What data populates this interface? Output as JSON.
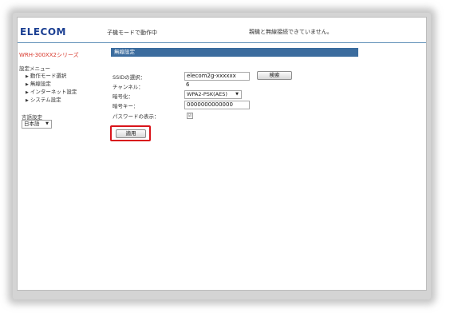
{
  "header": {
    "logo": "ELECOM",
    "mode_text": "子機モードで動作中",
    "status_text": "親機と無線接続できていません。"
  },
  "sidebar": {
    "series": "WRH-300XX2シリーズ",
    "menu_title": "設定メニュー",
    "items": [
      {
        "label": "動作モード選択"
      },
      {
        "label": "無線設定"
      },
      {
        "label": "インターネット設定"
      },
      {
        "label": "システム設定"
      }
    ],
    "language_label": "言語設定",
    "language_value": "日本語"
  },
  "main": {
    "section_title": "無線設定",
    "ssid_label": "SSIDの選択：",
    "ssid_value": "elecom2g-xxxxxx",
    "search_button": "検索",
    "channel_label": "チャンネル：",
    "channel_value": "6",
    "encryption_label": "暗号化：",
    "encryption_value": "WPA2-PSK(AES)",
    "key_label": "暗号キー：",
    "key_value": "0000000000000",
    "show_password_label": "パスワードの表示：",
    "show_password_checked": "☑",
    "apply_button": "適用"
  },
  "colors": {
    "brand": "#1b3f92",
    "section_bar": "#3b6c9e",
    "series_text": "#d83a2e",
    "highlight": "#d9141a"
  }
}
